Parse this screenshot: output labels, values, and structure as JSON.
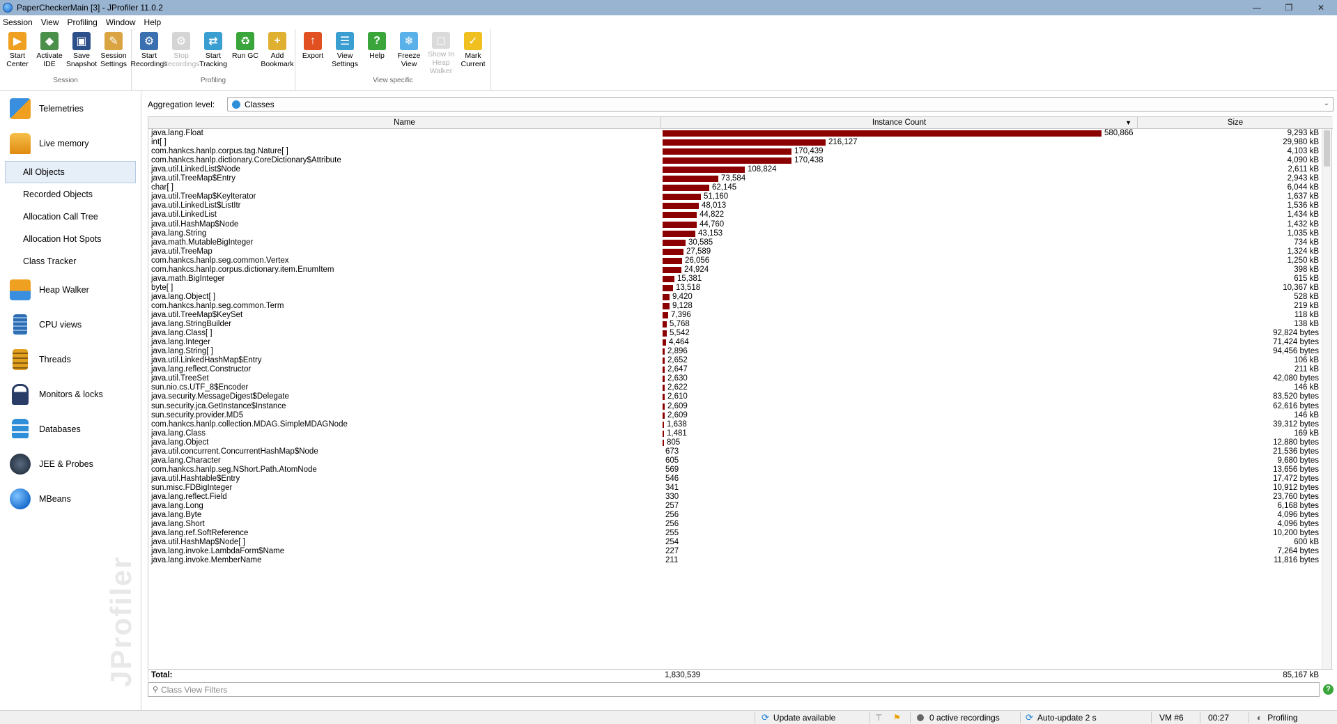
{
  "window": {
    "title": "PaperCheckerMain [3] - JProfiler 11.0.2",
    "minimize": "—",
    "maximize": "❐",
    "close": "✕"
  },
  "menu": [
    "Session",
    "View",
    "Profiling",
    "Window",
    "Help"
  ],
  "toolbar": {
    "groups": [
      {
        "label": "Session",
        "buttons": [
          {
            "label1": "Start",
            "label2": "Center",
            "icon": "start-center-icon",
            "color": "#f0a020",
            "enabled": true
          },
          {
            "label1": "Activate",
            "label2": "IDE",
            "icon": "activate-ide-icon",
            "color": "#4a8f4a",
            "enabled": true
          },
          {
            "label1": "Save",
            "label2": "Snapshot",
            "icon": "save-snapshot-icon",
            "color": "#2d4f8a",
            "enabled": true
          },
          {
            "label1": "Session",
            "label2": "Settings",
            "icon": "session-settings-icon",
            "color": "#d9a441",
            "enabled": true
          }
        ]
      },
      {
        "label": "Profiling",
        "buttons": [
          {
            "label1": "Start",
            "label2": "Recordings",
            "icon": "start-recordings-icon",
            "color": "#3a6fb0",
            "enabled": true
          },
          {
            "label1": "Stop",
            "label2": "Recordings",
            "icon": "stop-recordings-icon",
            "color": "#888888",
            "enabled": false
          },
          {
            "label1": "Start",
            "label2": "Tracking",
            "icon": "start-tracking-icon",
            "color": "#3a9fd0",
            "enabled": true
          },
          {
            "label1": "Run GC",
            "label2": "",
            "icon": "run-gc-icon",
            "color": "#3aa53a",
            "enabled": true
          },
          {
            "label1": "Add",
            "label2": "Bookmark",
            "icon": "add-bookmark-icon",
            "color": "#e0b030",
            "enabled": true
          }
        ]
      },
      {
        "label": "View specific",
        "buttons": [
          {
            "label1": "Export",
            "label2": "",
            "icon": "export-icon",
            "color": "#e05020",
            "enabled": true
          },
          {
            "label1": "View",
            "label2": "Settings",
            "icon": "view-settings-icon",
            "color": "#3a9fd0",
            "enabled": true
          },
          {
            "label1": "Help",
            "label2": "",
            "icon": "help-icon",
            "color": "#3aa53a",
            "enabled": true
          },
          {
            "label1": "Freeze",
            "label2": "View",
            "icon": "freeze-view-icon",
            "color": "#5ab0e8",
            "enabled": true
          },
          {
            "label1": "Show In",
            "label2": "Heap Walker",
            "icon": "show-in-heap-walker-icon",
            "color": "#999999",
            "enabled": false
          },
          {
            "label1": "Mark",
            "label2": "Current",
            "icon": "mark-current-icon",
            "color": "#f0c020",
            "enabled": true
          }
        ]
      }
    ]
  },
  "sidebar": {
    "telemetries": "Telemetries",
    "live_memory": "Live memory",
    "sub": [
      "All Objects",
      "Recorded Objects",
      "Allocation Call Tree",
      "Allocation Hot Spots",
      "Class Tracker"
    ],
    "rest": [
      "Heap Walker",
      "CPU views",
      "Threads",
      "Monitors & locks",
      "Databases",
      "JEE & Probes",
      "MBeans"
    ],
    "watermark": "JProfiler"
  },
  "main": {
    "aggregation_label": "Aggregation level:",
    "aggregation_value": "Classes",
    "columns": {
      "name": "Name",
      "count": "Instance Count",
      "size": "Size"
    },
    "rows": [
      {
        "name": "java.lang.Float",
        "count": 580866,
        "count_text": "580,866",
        "size": "9,293 kB"
      },
      {
        "name": "int[ ]",
        "count": 216127,
        "count_text": "216,127",
        "size": "29,980 kB"
      },
      {
        "name": "com.hankcs.hanlp.corpus.tag.Nature[ ]",
        "count": 170439,
        "count_text": "170,439",
        "size": "4,103 kB"
      },
      {
        "name": "com.hankcs.hanlp.dictionary.CoreDictionary$Attribute",
        "count": 170438,
        "count_text": "170,438",
        "size": "4,090 kB"
      },
      {
        "name": "java.util.LinkedList$Node",
        "count": 108824,
        "count_text": "108,824",
        "size": "2,611 kB"
      },
      {
        "name": "java.util.TreeMap$Entry",
        "count": 73584,
        "count_text": "73,584",
        "size": "2,943 kB"
      },
      {
        "name": "char[ ]",
        "count": 62145,
        "count_text": "62,145",
        "size": "6,044 kB"
      },
      {
        "name": "java.util.TreeMap$KeyIterator",
        "count": 51160,
        "count_text": "51,160",
        "size": "1,637 kB"
      },
      {
        "name": "java.util.LinkedList$ListItr",
        "count": 48013,
        "count_text": "48,013",
        "size": "1,536 kB"
      },
      {
        "name": "java.util.LinkedList",
        "count": 44822,
        "count_text": "44,822",
        "size": "1,434 kB"
      },
      {
        "name": "java.util.HashMap$Node",
        "count": 44760,
        "count_text": "44,760",
        "size": "1,432 kB"
      },
      {
        "name": "java.lang.String",
        "count": 43153,
        "count_text": "43,153",
        "size": "1,035 kB"
      },
      {
        "name": "java.math.MutableBigInteger",
        "count": 30585,
        "count_text": "30,585",
        "size": "734 kB"
      },
      {
        "name": "java.util.TreeMap",
        "count": 27589,
        "count_text": "27,589",
        "size": "1,324 kB"
      },
      {
        "name": "com.hankcs.hanlp.seg.common.Vertex",
        "count": 26056,
        "count_text": "26,056",
        "size": "1,250 kB"
      },
      {
        "name": "com.hankcs.hanlp.corpus.dictionary.item.EnumItem",
        "count": 24924,
        "count_text": "24,924",
        "size": "398 kB"
      },
      {
        "name": "java.math.BigInteger",
        "count": 15381,
        "count_text": "15,381",
        "size": "615 kB"
      },
      {
        "name": "byte[ ]",
        "count": 13518,
        "count_text": "13,518",
        "size": "10,367 kB"
      },
      {
        "name": "java.lang.Object[ ]",
        "count": 9420,
        "count_text": "9,420",
        "size": "528 kB"
      },
      {
        "name": "com.hankcs.hanlp.seg.common.Term",
        "count": 9128,
        "count_text": "9,128",
        "size": "219 kB"
      },
      {
        "name": "java.util.TreeMap$KeySet",
        "count": 7396,
        "count_text": "7,396",
        "size": "118 kB"
      },
      {
        "name": "java.lang.StringBuilder",
        "count": 5768,
        "count_text": "5,768",
        "size": "138 kB"
      },
      {
        "name": "java.lang.Class[ ]",
        "count": 5542,
        "count_text": "5,542",
        "size": "92,824 bytes"
      },
      {
        "name": "java.lang.Integer",
        "count": 4464,
        "count_text": "4,464",
        "size": "71,424 bytes"
      },
      {
        "name": "java.lang.String[ ]",
        "count": 2896,
        "count_text": "2,896",
        "size": "94,456 bytes"
      },
      {
        "name": "java.util.LinkedHashMap$Entry",
        "count": 2652,
        "count_text": "2,652",
        "size": "106 kB"
      },
      {
        "name": "java.lang.reflect.Constructor",
        "count": 2647,
        "count_text": "2,647",
        "size": "211 kB"
      },
      {
        "name": "java.util.TreeSet",
        "count": 2630,
        "count_text": "2,630",
        "size": "42,080 bytes"
      },
      {
        "name": "sun.nio.cs.UTF_8$Encoder",
        "count": 2622,
        "count_text": "2,622",
        "size": "146 kB"
      },
      {
        "name": "java.security.MessageDigest$Delegate",
        "count": 2610,
        "count_text": "2,610",
        "size": "83,520 bytes"
      },
      {
        "name": "sun.security.jca.GetInstance$Instance",
        "count": 2609,
        "count_text": "2,609",
        "size": "62,616 bytes"
      },
      {
        "name": "sun.security.provider.MD5",
        "count": 2609,
        "count_text": "2,609",
        "size": "146 kB"
      },
      {
        "name": "com.hankcs.hanlp.collection.MDAG.SimpleMDAGNode",
        "count": 1638,
        "count_text": "1,638",
        "size": "39,312 bytes"
      },
      {
        "name": "java.lang.Class",
        "count": 1481,
        "count_text": "1,481",
        "size": "169 kB"
      },
      {
        "name": "java.lang.Object",
        "count": 805,
        "count_text": "805",
        "size": "12,880 bytes"
      },
      {
        "name": "java.util.concurrent.ConcurrentHashMap$Node",
        "count": 673,
        "count_text": "673",
        "size": "21,536 bytes"
      },
      {
        "name": "java.lang.Character",
        "count": 605,
        "count_text": "605",
        "size": "9,680 bytes"
      },
      {
        "name": "com.hankcs.hanlp.seg.NShort.Path.AtomNode",
        "count": 569,
        "count_text": "569",
        "size": "13,656 bytes"
      },
      {
        "name": "java.util.Hashtable$Entry",
        "count": 546,
        "count_text": "546",
        "size": "17,472 bytes"
      },
      {
        "name": "sun.misc.FDBigInteger",
        "count": 341,
        "count_text": "341",
        "size": "10,912 bytes"
      },
      {
        "name": "java.lang.reflect.Field",
        "count": 330,
        "count_text": "330",
        "size": "23,760 bytes"
      },
      {
        "name": "java.lang.Long",
        "count": 257,
        "count_text": "257",
        "size": "6,168 bytes"
      },
      {
        "name": "java.lang.Byte",
        "count": 256,
        "count_text": "256",
        "size": "4,096 bytes"
      },
      {
        "name": "java.lang.Short",
        "count": 256,
        "count_text": "256",
        "size": "4,096 bytes"
      },
      {
        "name": "java.lang.ref.SoftReference",
        "count": 255,
        "count_text": "255",
        "size": "10,200 bytes"
      },
      {
        "name": "java.util.HashMap$Node[ ]",
        "count": 254,
        "count_text": "254",
        "size": "600 kB"
      },
      {
        "name": "java.lang.invoke.LambdaForm$Name",
        "count": 227,
        "count_text": "227",
        "size": "7,264 bytes"
      },
      {
        "name": "java.lang.invoke.MemberName",
        "count": 211,
        "count_text": "211",
        "size": "11,816 bytes"
      }
    ],
    "total_label": "Total:",
    "total_count": "1,830,539",
    "total_size": "85,167 kB",
    "filter_placeholder": "Class View Filters",
    "bar_color": "#8b0000"
  },
  "status": {
    "update": "Update available",
    "recordings": "0 active recordings",
    "autoupdate": "Auto-update 2 s",
    "vm": "VM #6",
    "time": "00:27",
    "mode": "Profiling"
  }
}
